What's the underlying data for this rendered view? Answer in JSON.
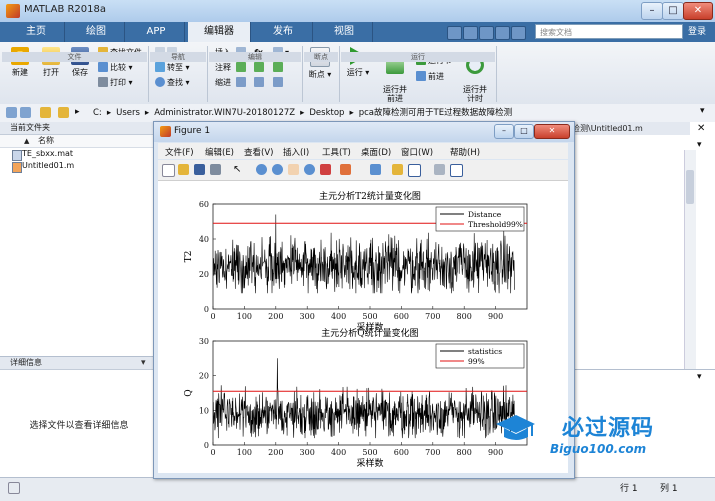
{
  "window": {
    "title": "MATLAB R2018a"
  },
  "tabs": [
    "主页",
    "绘图",
    "APP",
    "编辑器",
    "发布",
    "视图"
  ],
  "active_tab": "编辑器",
  "search": {
    "placeholder": "搜索文档"
  },
  "signin_label": "登录",
  "ribbon": {
    "file_group": {
      "label": "文件",
      "new": "新建",
      "open": "打开",
      "save": "保存",
      "find_files": "查找文件",
      "compare": "比较",
      "print": "打印"
    },
    "nav_group": {
      "label": "导航",
      "goto": "转至",
      "find": "查找"
    },
    "edit_group": {
      "label": "编辑",
      "insert": "插入",
      "comment": "注释",
      "indent": "缩进",
      "fx": "fx"
    },
    "breakpoint_group": {
      "label": "断点",
      "breakpoints": "断点"
    },
    "run_group": {
      "label": "运行",
      "run": "运行",
      "run_advance": "运行并\n前进",
      "run_section": "运行节",
      "advance": "前进",
      "run_time": "运行并\n计时"
    }
  },
  "address": {
    "segments": [
      "C:",
      "Users",
      "Administrator.WIN7U-20180127Z",
      "Desktop",
      "pca故障检测可用于TE过程数据故障检测"
    ]
  },
  "current_folder": {
    "title": "当前文件夹",
    "col_name": "名称",
    "sort_indicator": "▲",
    "files": [
      {
        "name": "TE_sbxx.mat",
        "icon": "mat-file-icon"
      },
      {
        "name": "Untitled01.m",
        "icon": "m-file-icon"
      }
    ]
  },
  "details": {
    "title": "详细信息",
    "message": "选择文件以查看详细信息"
  },
  "editor_tab_text": "检测\\Untitled01.m",
  "status": {
    "row_label": "行",
    "row": "1",
    "col_label": "列",
    "col": "1"
  },
  "figure": {
    "title": "Figure 1",
    "menus": [
      "文件(F)",
      "编辑(E)",
      "查看(V)",
      "插入(I)",
      "工具(T)",
      "桌面(D)",
      "窗口(W)",
      "帮助(H)"
    ]
  },
  "watermark": {
    "text": "必过源码",
    "sub": "Biguo100.com"
  },
  "chart_data": [
    {
      "type": "line",
      "title": "主元分析T2统计量变化图",
      "xlabel": "采样数",
      "ylabel": "T2",
      "xlim": [
        0,
        1000
      ],
      "ylim": [
        0,
        60
      ],
      "xticks": [
        0,
        100,
        200,
        300,
        400,
        500,
        600,
        700,
        800,
        900
      ],
      "yticks": [
        0,
        20,
        40,
        60
      ],
      "legend_position": "top-right",
      "series": [
        {
          "name": "Distance",
          "color": "#000000",
          "n_points": 960,
          "mean": 25,
          "min": 9,
          "max": 54,
          "peak_x": 200,
          "peak_y": 54
        },
        {
          "name": "Threshold99%",
          "color": "#e01010",
          "constant": 49
        }
      ]
    },
    {
      "type": "line",
      "title": "主元分析Q统计量变化图",
      "xlabel": "采样数",
      "ylabel": "Q",
      "xlim": [
        0,
        1000
      ],
      "ylim": [
        0,
        30
      ],
      "xticks": [
        0,
        100,
        200,
        300,
        400,
        500,
        600,
        700,
        800,
        900
      ],
      "yticks": [
        0,
        10,
        20,
        30
      ],
      "legend_position": "top-right",
      "series": [
        {
          "name": "statistics",
          "color": "#000000",
          "n_points": 960,
          "mean": 9,
          "min": 2,
          "max": 25,
          "peak_x": 205,
          "peak_y": 25
        },
        {
          "name": "99%",
          "color": "#e01010",
          "constant": 15.5
        }
      ]
    }
  ]
}
